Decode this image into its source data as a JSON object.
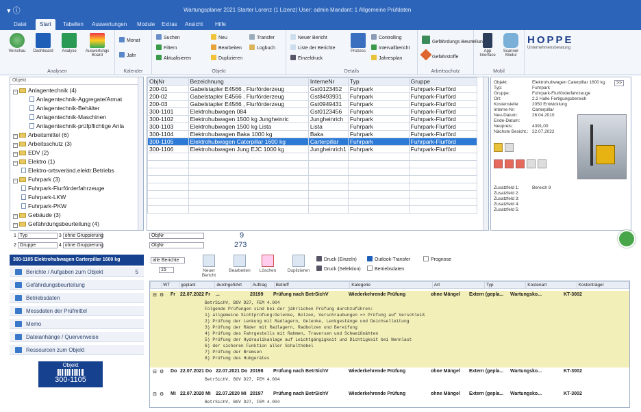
{
  "window": {
    "title": "Wartungsplaner 2021 Starter Lorenz (1 Lizenz)  User: admin   Mandant: 1 Allgemeine Prüfdaten"
  },
  "menu": [
    "Datei",
    "Start",
    "Tabellen",
    "Auswertungen",
    "Module",
    "Extras",
    "Ansicht",
    "Hilfe"
  ],
  "ribbon": {
    "analysen": {
      "caption": "Analysen",
      "buttons": [
        "Verschau",
        "Dashboard",
        "Analyse",
        "Auswertungs Board"
      ]
    },
    "kalender": {
      "caption": "Kalender",
      "buttons": [
        "Monat",
        "Jahr"
      ]
    },
    "objekt": {
      "caption": "Objekt",
      "items": [
        "Suchen",
        "Neu",
        "Transfer",
        "Filtern",
        "Bearbeiten",
        "Logbuch",
        "Aktualisieren",
        "Duplizieren"
      ]
    },
    "details": {
      "caption": "Details",
      "items": [
        "Neuer Bericht",
        "Liste der Berichte",
        "Einzeldruck",
        "Prozess",
        "Controlling",
        "Intervallbericht",
        "Jahresplan"
      ]
    },
    "arbeitsschutz": {
      "caption": "Arbeitsschutz",
      "items": [
        "Gefährdungs Beurteilung",
        "Gefahrstoffe"
      ]
    },
    "mobil": {
      "caption": "Mobil",
      "items": [
        "App Interface",
        "Scanner Modul"
      ]
    },
    "brand": {
      "name": "HOPPE",
      "tagline": "Unternehmensberatung"
    }
  },
  "tree": {
    "search_label": "Objekt",
    "nodes": [
      {
        "label": "Anlagentechnik  (4)",
        "level": 0
      },
      {
        "label": "Anlagentechnik-Aggregate/Armat",
        "level": 2
      },
      {
        "label": "Anlagentechnik-Behälter",
        "level": 2
      },
      {
        "label": "Anlagentechnik-Maschinen",
        "level": 2
      },
      {
        "label": "Anlagentechnik-prüfpflichtige Anla",
        "level": 2
      },
      {
        "label": "Arbeitsmittel  (6)",
        "level": 0
      },
      {
        "label": "Arbeitsschutz  (3)",
        "level": 0
      },
      {
        "label": "EDV  (2)",
        "level": 0
      },
      {
        "label": "Elektro  (1)",
        "level": 0
      },
      {
        "label": "Elektro-ortsveränd.elektr.Betriebs",
        "level": 1
      },
      {
        "label": "Fuhrpark  (3)",
        "level": 0
      },
      {
        "label": "Fuhrpark-Flurförderfahrzeuge",
        "level": 1
      },
      {
        "label": "Fuhrpark-LKW",
        "level": 1
      },
      {
        "label": "Fuhrpark-PKW",
        "level": 1
      },
      {
        "label": "Gebäude  (3)",
        "level": 0
      },
      {
        "label": "Gefährdungsbeurteilung  (4)",
        "level": 0
      }
    ]
  },
  "objects": {
    "columns": [
      "ObjNr",
      "Bezeichnung",
      "InterneNr",
      "Typ",
      "Gruppe"
    ],
    "rows": [
      [
        "200-01",
        "Gabelstapler E4566 , Flurförderzeug",
        "Gst0123452",
        "Fuhrpark",
        "Fuhrpark-Flurförd"
      ],
      [
        "200-02",
        "Gabelstapler E4566 , Flurförderzeug",
        "Gst8493931",
        "Fuhrpark",
        "Fuhrpark-Flurförd"
      ],
      [
        "200-03",
        "Gabelstapler E4566 , Flurförderzeug",
        "Gst0949431",
        "Fuhrpark",
        "Fuhrpark-Flurförd"
      ],
      [
        "300-1101",
        "Elektrohubwagen 084",
        "Gst0123456",
        "Fuhrpark",
        "Fuhrpark-Flurförd"
      ],
      [
        "300-1102",
        "Elektrohubwagen 1500 kg  Jungheinric",
        "Jungheinrich",
        "Fuhrpark",
        "Fuhrpark-Flurförd"
      ],
      [
        "300-1103",
        "Elektrohubwagen 1500 kg Lista",
        "Lista",
        "Fuhrpark",
        "Fuhrpark-Flurförd"
      ],
      [
        "300-1104",
        "Elektrohubwagen Baka 1000 kg",
        "Baka",
        "Fuhrpark",
        "Fuhrpark-Flurförd"
      ],
      [
        "300-1105",
        "Elektrohubwagen Caterpillar 1600 kg",
        "Carterpillar",
        "Fuhrpark",
        "Fuhrpark-Flurförd"
      ],
      [
        "300-1106",
        "Elektrohubwagen Jung EJC 1000 kg",
        "Jungheinrich1",
        "Fuhrpark",
        "Fuhrpark-Flurförd"
      ]
    ],
    "selected_index": 7
  },
  "detail": {
    "fields": [
      [
        "Objekt:",
        "Elektrohubwagen Caterpillar 1600 kg"
      ],
      [
        "Typ:",
        "Fuhrpark"
      ],
      [
        "Gruppe:",
        "Fuhrpark-Flurförderfahrzeuge"
      ],
      [
        "Ort:",
        "2.2 Halle Fertigungsbereich"
      ],
      [
        "Kostenstelle:",
        "2050 Entwicklung"
      ],
      [
        "Interne-Nr:",
        "Carterpillar"
      ],
      [
        "Neu-Datum:",
        "26.04.2010"
      ],
      [
        "Ende-Datum:",
        ""
      ],
      [
        "Neupreis:",
        "4391,00"
      ],
      [
        "Nächste Besicht.:",
        "22.07.2022"
      ]
    ],
    "zusatz": [
      [
        "Zusatzfeld 1:",
        "Bereich 9"
      ],
      [
        "Zusatzfeld 2:",
        ""
      ],
      [
        "Zusatzfeld 3:",
        ""
      ],
      [
        "Zusatzfeld 4:",
        ""
      ],
      [
        "Zusatzfeld 5:",
        ""
      ]
    ],
    "expand_label": ">>"
  },
  "filters": {
    "row1": {
      "n": "1",
      "field": "Typ",
      "n2": "3",
      "group": "ohne Gruppierung"
    },
    "row2": {
      "n": "2",
      "field": "Gruppe",
      "n2": "4",
      "group": "ohne Gruppierung"
    },
    "obj1": "ObjNr",
    "obj2": "ObjNr",
    "count1": "9",
    "count2": "273"
  },
  "selected_banner": "300-1105 Elektrohubwagen Carterpillar 1600 kg",
  "nav": [
    {
      "label": "Berichte / Aufgaben zum Objekt",
      "count": "5"
    },
    {
      "label": "Gefährdungsbeurteilung",
      "count": ""
    },
    {
      "label": "Betriebsdaten",
      "count": ""
    },
    {
      "label": "Messdaten der Prüfmittel",
      "count": ""
    },
    {
      "label": "Memo",
      "count": ""
    },
    {
      "label": "Dateianhänge / Querverweise",
      "count": ""
    },
    {
      "label": "Ressourcen zum Objekt",
      "count": ""
    }
  ],
  "objbox": {
    "label": "Objekt",
    "code": "300-1105"
  },
  "tasktools": {
    "filter": "alle Berichte",
    "count": "15",
    "buttons": [
      "Neuer Bericht",
      "Bearbeiten",
      "Löschen",
      "Duplizieren"
    ],
    "print": [
      "Druck (Einzeln)",
      "Druck (Selektion)"
    ],
    "outlook": "Outlook-Transfer",
    "prognose": "Prognose",
    "betrieb": "Betriebsdaten"
  },
  "tasks": {
    "columns": [
      "WT",
      "geplant",
      "durchgeführt",
      "Auftrag",
      "Betreff",
      "Kategorie",
      "Art",
      "Typ",
      "Kostenart",
      "Kostenträger"
    ],
    "rows": [
      {
        "wt": "Fr",
        "geplant": "22.07.2022 Fr",
        "durch": "...",
        "auftrag": "20199",
        "betreff": "Prüfung nach BetrSichV",
        "kategorie": "Wiederkehrende Prüfung",
        "art": "ohne Mängel",
        "typ": "Extern (gepla...",
        "kostenart": "Wartungsko...",
        "kt": "KT-3002",
        "desc": [
          "BetrSichV, BGV D27, FEM 4.004",
          "Folgende Prüfungen sind bei der jährlichen Prüfung durchzuführen:",
          "1) allgemeine Sichtprüfung:Gelenke, Bolzen, Verschraubungen => Prüfung auf Verschleiß",
          "2) Prüfung der Lenkung mit Radlagern, Gelenke, Lenkgestänge und Deichselleitung",
          "3) Prüfung der Räder mit Radlagern, Radbolzen und Bereifung",
          "4) Prüfung des Fahrgestells mit Rahmen, Traversen und Schweißnähten",
          "5) Prüfung der Hydraulikanlage auf Leichtgängigkeit und Dichtigkeit bei Nennlast",
          "6) der sicheren Funktion aller Schalthebel",
          "7) Prüfung der Bremsen",
          "8) Prüfung des Hubgerätes"
        ]
      },
      {
        "wt": "Do",
        "geplant": "22.07.2021 Do",
        "durch": "22.07.2021 Do",
        "auftrag": "20198",
        "betreff": "Prüfung nach BetrSichV",
        "kategorie": "Wiederkehrende Prüfung",
        "art": "ohne Mängel",
        "typ": "Extern (gepla...",
        "kostenart": "Wartungsko...",
        "kt": "KT-3002",
        "desc": [
          "BetrSichV, BGV D27, FEM 4.004"
        ]
      },
      {
        "wt": "Mi",
        "geplant": "22.07.2020 Mi",
        "durch": "22.07.2020 Mi",
        "auftrag": "20197",
        "betreff": "Prüfung nach BetrSichV",
        "kategorie": "Wiederkehrende Prüfung",
        "art": "ohne Mängel",
        "typ": "Extern (gepla...",
        "kostenart": "Wartungsko...",
        "kt": "KT-3002",
        "desc": [
          "BetrSichV, BGV D27, FEM 4.004"
        ]
      }
    ]
  }
}
